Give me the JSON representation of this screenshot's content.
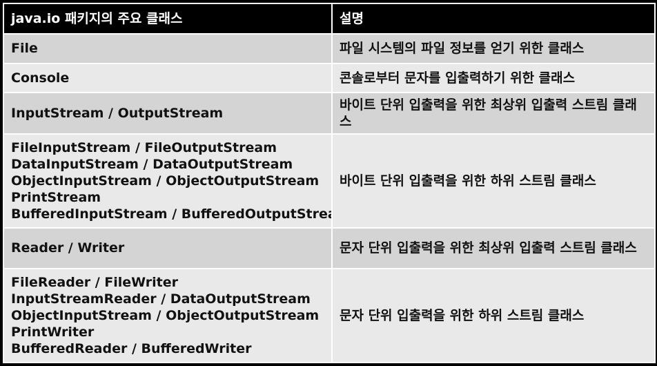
{
  "table": {
    "headers": [
      "java.io 패키지의 주요 클래스",
      "설명"
    ],
    "rows": [
      {
        "classes": [
          "File"
        ],
        "description": "파일 시스템의 파일 정보를 얻기 위한 클래스"
      },
      {
        "classes": [
          "Console"
        ],
        "description": "콘솔로부터 문자를 입출력하기 위한 클래스"
      },
      {
        "classes": [
          "InputStream / OutputStream"
        ],
        "description": "바이트 단위 입출력을 위한 최상위 입출력 스트림 클래스"
      },
      {
        "classes": [
          "FileInputStream / FileOutputStream",
          "DataInputStream / DataOutputStream",
          "ObjectInputStream / ObjectOutputStream",
          "PrintStream",
          "BufferedInputStream / BufferedOutputStream"
        ],
        "description": "바이트 단위 입출력을 위한 하위 스트림 클래스"
      },
      {
        "classes": [
          "Reader / Writer"
        ],
        "description": "문자 단위 입출력을 위한 최상위 입출력 스트림 클래스"
      },
      {
        "classes": [
          "FileReader / FileWriter",
          "InputStreamReader / DataOutputStream",
          "ObjectInputStream / ObjectOutputStream",
          "PrintWriter",
          "BufferedReader / BufferedWriter"
        ],
        "description": "문자 단위 입출력을 위한 하위 스트림 클래스"
      }
    ]
  }
}
